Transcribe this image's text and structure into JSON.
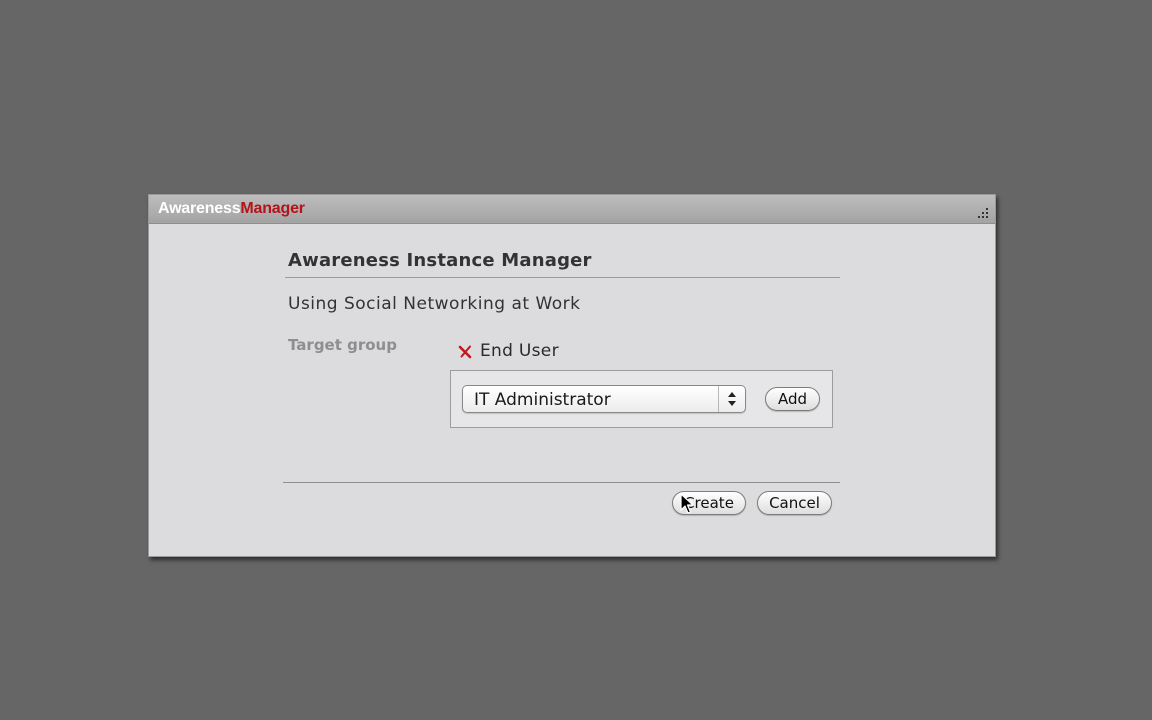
{
  "app": {
    "brand_part1": "Awareness",
    "brand_part2": "Manager"
  },
  "dialog": {
    "heading": "Awareness Instance Manager",
    "subtitle": "Using Social Networking at Work",
    "target_group_label": "Target group",
    "selected_groups": [
      {
        "label": "End User",
        "icon": "remove-x-icon"
      }
    ],
    "group_select": {
      "value": "IT Administrator"
    },
    "add_label": "Add",
    "create_label": "Create",
    "cancel_label": "Cancel"
  },
  "colors": {
    "brand_red": "#b5121b",
    "background": "#666666",
    "window": "#dcdcdf"
  }
}
